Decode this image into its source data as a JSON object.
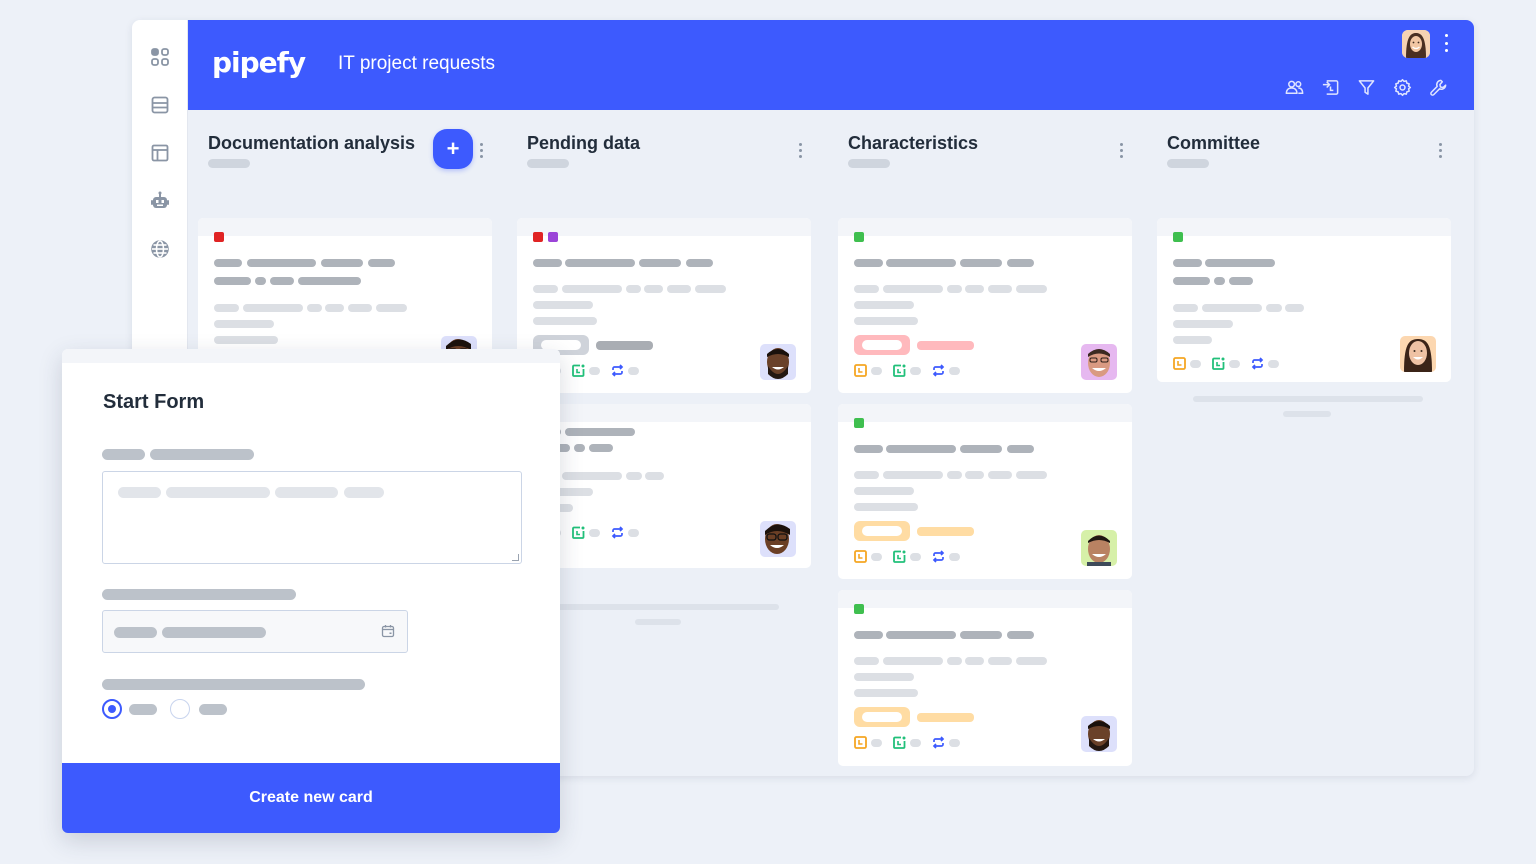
{
  "app": {
    "logo": "pipefy",
    "pipe_title": "IT project requests",
    "accent_color": "#3d5afe"
  },
  "sidebar": {
    "items": [
      {
        "icon": "apps-grid-icon"
      },
      {
        "icon": "database-table-icon"
      },
      {
        "icon": "layout-panel-icon"
      },
      {
        "icon": "robot-automation-icon"
      },
      {
        "icon": "globe-portal-icon"
      }
    ]
  },
  "header": {
    "user_avatar": "user-avatar-woman",
    "tools": [
      {
        "icon": "members-icon"
      },
      {
        "icon": "import-icon"
      },
      {
        "icon": "filter-icon"
      },
      {
        "icon": "settings-gear-icon"
      },
      {
        "icon": "wrench-icon"
      }
    ]
  },
  "columns": [
    {
      "title": "Documentation analysis",
      "has_add_button": true,
      "add_label": "+",
      "cards": [
        {
          "labels": [
            "#e02424"
          ],
          "badge": null
        }
      ]
    },
    {
      "title": "Pending data",
      "has_add_button": false,
      "cards": [
        {
          "labels": [
            "#e02424",
            "#9b44d8"
          ],
          "badge": "gray"
        },
        {
          "labels": [],
          "badge": null
        }
      ]
    },
    {
      "title": "Characteristics",
      "has_add_button": false,
      "cards": [
        {
          "labels": [
            "#3fbf4f"
          ],
          "badge": "red"
        },
        {
          "labels": [
            "#3fbf4f"
          ],
          "badge": "orange"
        },
        {
          "labels": [
            "#3fbf4f"
          ],
          "badge": "orange"
        }
      ]
    },
    {
      "title": "Committee",
      "has_add_button": false,
      "cards": [
        {
          "labels": [
            "#3fbf4f"
          ],
          "badge": null
        }
      ]
    }
  ],
  "start_form": {
    "title": "Start Form",
    "radio_selected_index": 0,
    "submit_label": "Create new card"
  },
  "colors": {
    "label_red": "#e02424",
    "label_purple": "#9b44d8",
    "label_green": "#3fbf4f",
    "due_icon": "#f5a623",
    "late_icon": "#21c07a",
    "repeat_icon": "#3d5afe",
    "badge_red": "#ffb9bd",
    "badge_orange": "#ffdca3",
    "badge_gray": "#cfd3da"
  }
}
